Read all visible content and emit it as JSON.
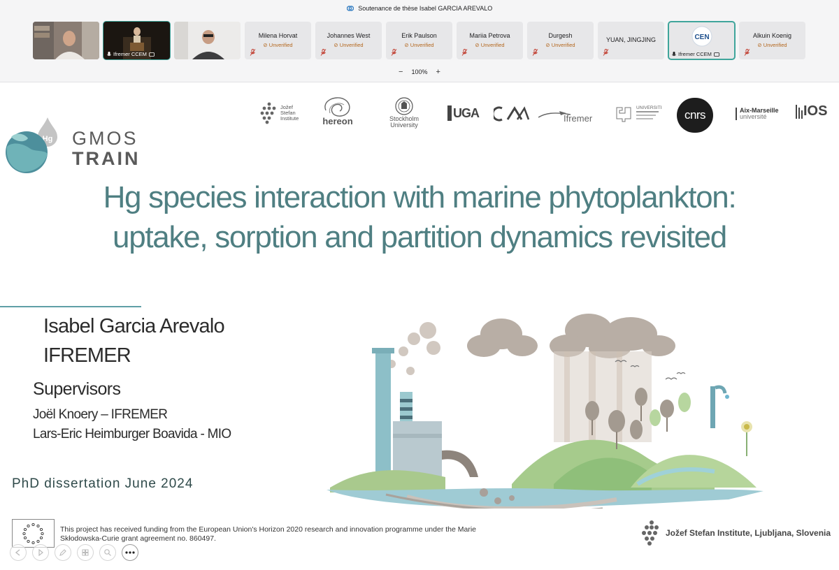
{
  "window": {
    "title": "Soutenance de thèse Isabel GARCIA AREVALO"
  },
  "participants": [
    {
      "kind": "video"
    },
    {
      "kind": "video",
      "name": "Ifremer CCEM",
      "active": true
    },
    {
      "kind": "video"
    },
    {
      "kind": "name",
      "name": "Milena Horvat",
      "status": "Unverified"
    },
    {
      "kind": "name",
      "name": "Johannes West",
      "status": "Unverified"
    },
    {
      "kind": "name",
      "name": "Erik Paulson",
      "status": "Unverified"
    },
    {
      "kind": "name",
      "name": "Mariia Petrova",
      "status": "Unverified"
    },
    {
      "kind": "name",
      "name": "Durgesh",
      "status": "Unverified"
    },
    {
      "kind": "name",
      "name": "YUAN, JINGJING",
      "status": ""
    },
    {
      "kind": "logo",
      "name": "Ifremer CCEM",
      "active": true
    },
    {
      "kind": "name",
      "name": "Alkuin Koenig",
      "status": "Unverified"
    }
  ],
  "zoom": {
    "level": "100%",
    "minus": "−",
    "plus": "+"
  },
  "slide": {
    "partners": {
      "jsi": [
        "Jožef",
        "Stefan",
        "Institute"
      ],
      "hereon": "hereon",
      "stockholm": [
        "Stockholm",
        "University"
      ],
      "uga": "UGA",
      "ifremer": "Ifremer",
      "cnrs": "cnrs",
      "amu": [
        "Aix-Marseille",
        "université"
      ],
      "ios": "IOS"
    },
    "brand": {
      "line1": "GMOS",
      "line2": "TRAIN",
      "hg": "Hg"
    },
    "title": [
      "Hg species interaction with marine phytoplankton:",
      "uptake, sorption and partition dynamics revisited"
    ],
    "author": [
      "Isabel Garcia Arevalo",
      "IFREMER"
    ],
    "supervisors_heading": "Supervisors",
    "supervisors": [
      "Joël Knoery – IFREMER",
      "Lars-Eric Heimburger Boavida - MIO"
    ],
    "date_line": "PhD dissertation June 2024",
    "funding": [
      "This project has received funding from the European Union's Horizon 2020 research and innovation programme under the Marie",
      "Skłodowska-Curie grant agreement no. 860497."
    ],
    "footer_institute": "Jožef Stefan Institute, Ljubljana, Slovenia"
  },
  "colors": {
    "title": "#4f7f82",
    "accent": "#3fa59b",
    "unverified": "#b3661c"
  },
  "controls": [
    "back-icon",
    "play-icon",
    "pen-icon",
    "grid-icon",
    "search-icon",
    "more-icon"
  ]
}
